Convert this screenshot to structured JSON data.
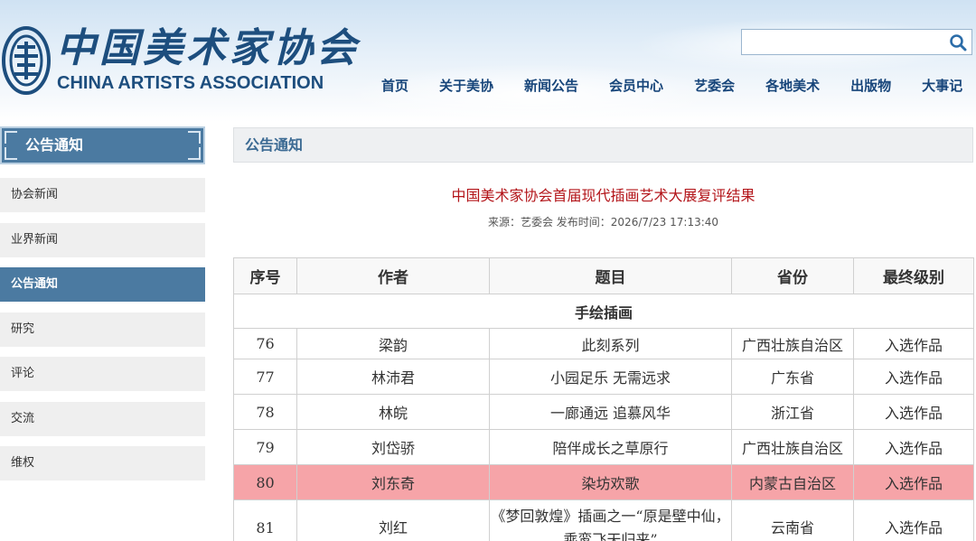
{
  "header": {
    "logo_cn": "中国美术家协会",
    "logo_en": "CHINA ARTISTS ASSOCIATION",
    "search": {
      "value": "",
      "placeholder": ""
    },
    "nav": [
      {
        "label": "首页"
      },
      {
        "label": "关于美协"
      },
      {
        "label": "新闻公告"
      },
      {
        "label": "会员中心"
      },
      {
        "label": "艺委会"
      },
      {
        "label": "各地美术"
      },
      {
        "label": "出版物"
      },
      {
        "label": "大事记"
      }
    ]
  },
  "sidebar": {
    "title": "公告通知",
    "items": [
      {
        "label": "协会新闻",
        "active": false
      },
      {
        "label": "业界新闻",
        "active": false
      },
      {
        "label": "公告通知",
        "active": true
      },
      {
        "label": "研究",
        "active": false
      },
      {
        "label": "评论",
        "active": false
      },
      {
        "label": "交流",
        "active": false
      },
      {
        "label": "维权",
        "active": false
      }
    ]
  },
  "main": {
    "section_title": "公告通知",
    "article": {
      "title": "中国美术家协会首届现代插画艺术大展复评结果",
      "meta": "来源：艺委会 发布时间：2026/7/23 17:13:40"
    },
    "table": {
      "headers": [
        "序号",
        "作者",
        "题目",
        "省份",
        "最终级别"
      ],
      "section_label": "手绘插画",
      "rows": [
        {
          "no": "76",
          "author": "梁韵",
          "title": "此刻系列",
          "province": "广西壮族自治区",
          "level": "入选作品",
          "highlight": false
        },
        {
          "no": "77",
          "author": "林沛君",
          "title": "小园足乐 无需远求",
          "province": "广东省",
          "level": "入选作品",
          "highlight": false
        },
        {
          "no": "78",
          "author": "林皖",
          "title": "一廊通远 追慕风华",
          "province": "浙江省",
          "level": "入选作品",
          "highlight": false
        },
        {
          "no": "79",
          "author": "刘岱骄",
          "title": "陪伴成长之草原行",
          "province": "广西壮族自治区",
          "level": "入选作品",
          "highlight": false
        },
        {
          "no": "80",
          "author": "刘东奇",
          "title": "染坊欢歌",
          "province": "内蒙古自治区",
          "level": "入选作品",
          "highlight": true
        },
        {
          "no": "81",
          "author": "刘红",
          "title": "《梦回敦煌》插画之一“原是壁中仙，乘鸾飞天归来”",
          "province": "云南省",
          "level": "入选作品",
          "highlight": false
        }
      ]
    }
  },
  "colors": {
    "brand": "#1d4e7e",
    "sidebar_active": "#4b7aa1",
    "article_title": "#b3151a",
    "highlight_row": "#f6a4a8"
  }
}
